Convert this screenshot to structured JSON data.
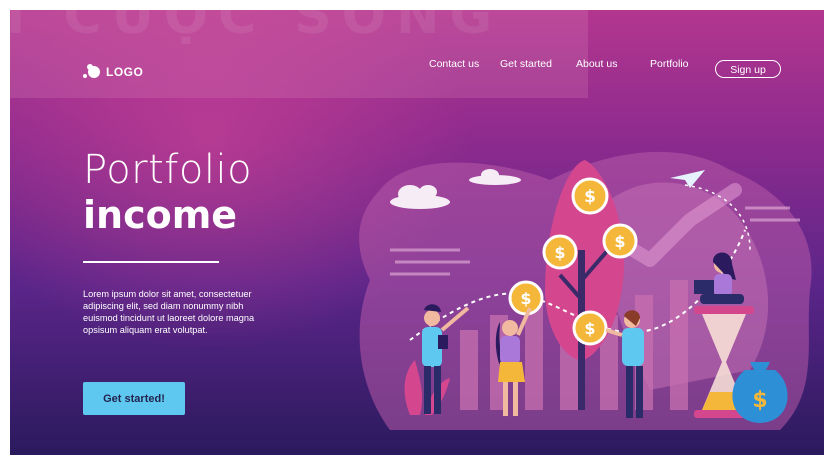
{
  "brand": {
    "logo_text": "LOGO",
    "watermark_text": "I CUỘC SỐNG"
  },
  "nav": {
    "links": [
      "Contact us",
      "Get started",
      "About us",
      "Portfolio"
    ],
    "signup_label": "Sign up"
  },
  "hero": {
    "title_line1": "Portfolio",
    "title_line2": "income",
    "body": "Lorem ipsum dolor sit amet, consectetuer adipiscing elit, sed diam nonummy nibh euismod tincidunt ut laoreet dolore magna opsisum aliquam erat volutpat.",
    "cta_label": "Get started!"
  },
  "illustration": {
    "coin_symbol": "$",
    "money_bag_symbol": "$"
  },
  "colors": {
    "accent_cyan": "#5ec8f0",
    "coin_gold": "#f4b73a",
    "tree_pink": "#d4478f",
    "bar_pink": "#c870b0",
    "dark_navy": "#2b1a5e"
  }
}
